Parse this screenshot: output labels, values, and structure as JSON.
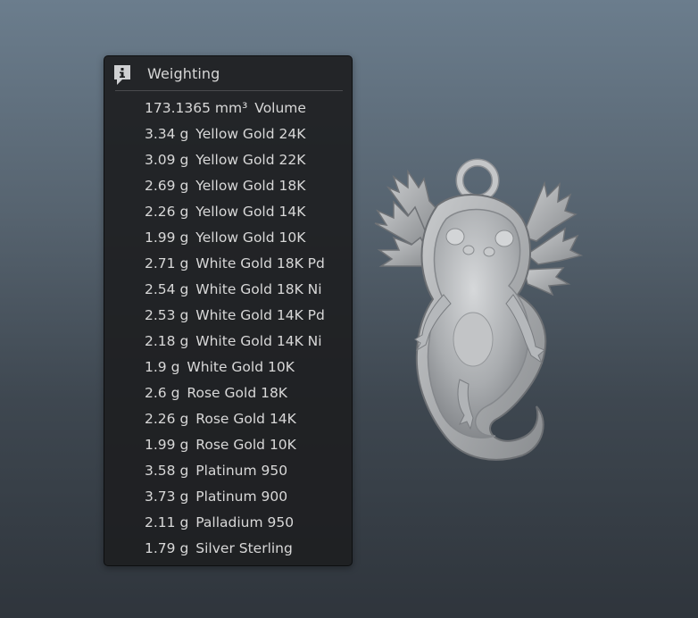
{
  "panel": {
    "title": "Weighting",
    "icon": "info-icon",
    "volume": {
      "value": "173.1365 mm³",
      "label": "Volume"
    },
    "rows": [
      {
        "value": "3.34 g",
        "label": "Yellow Gold 24K"
      },
      {
        "value": "3.09 g",
        "label": "Yellow Gold 22K"
      },
      {
        "value": "2.69 g",
        "label": "Yellow Gold 18K"
      },
      {
        "value": "2.26 g",
        "label": "Yellow Gold 14K"
      },
      {
        "value": "1.99 g",
        "label": "Yellow Gold 10K"
      },
      {
        "value": "2.71 g",
        "label": "White Gold 18K Pd"
      },
      {
        "value": "2.54 g",
        "label": "White Gold 18K Ni"
      },
      {
        "value": "2.53 g",
        "label": "White Gold 14K Pd"
      },
      {
        "value": "2.18 g",
        "label": "White Gold 14K Ni"
      },
      {
        "value": "1.9 g",
        "label": "White Gold 10K"
      },
      {
        "value": "2.6 g",
        "label": "Rose Gold 18K"
      },
      {
        "value": "2.26 g",
        "label": "Rose Gold 14K"
      },
      {
        "value": "1.99 g",
        "label": "Rose Gold 10K"
      },
      {
        "value": "3.58 g",
        "label": "Platinum 950"
      },
      {
        "value": "3.73 g",
        "label": "Platinum 900"
      },
      {
        "value": "2.11 g",
        "label": "Palladium 950"
      },
      {
        "value": "1.79 g",
        "label": "Silver Sterling"
      }
    ]
  },
  "colors": {
    "panel_bg": "#1e1f21",
    "text": "#d8d8d8",
    "model": "#b9bcbf"
  }
}
